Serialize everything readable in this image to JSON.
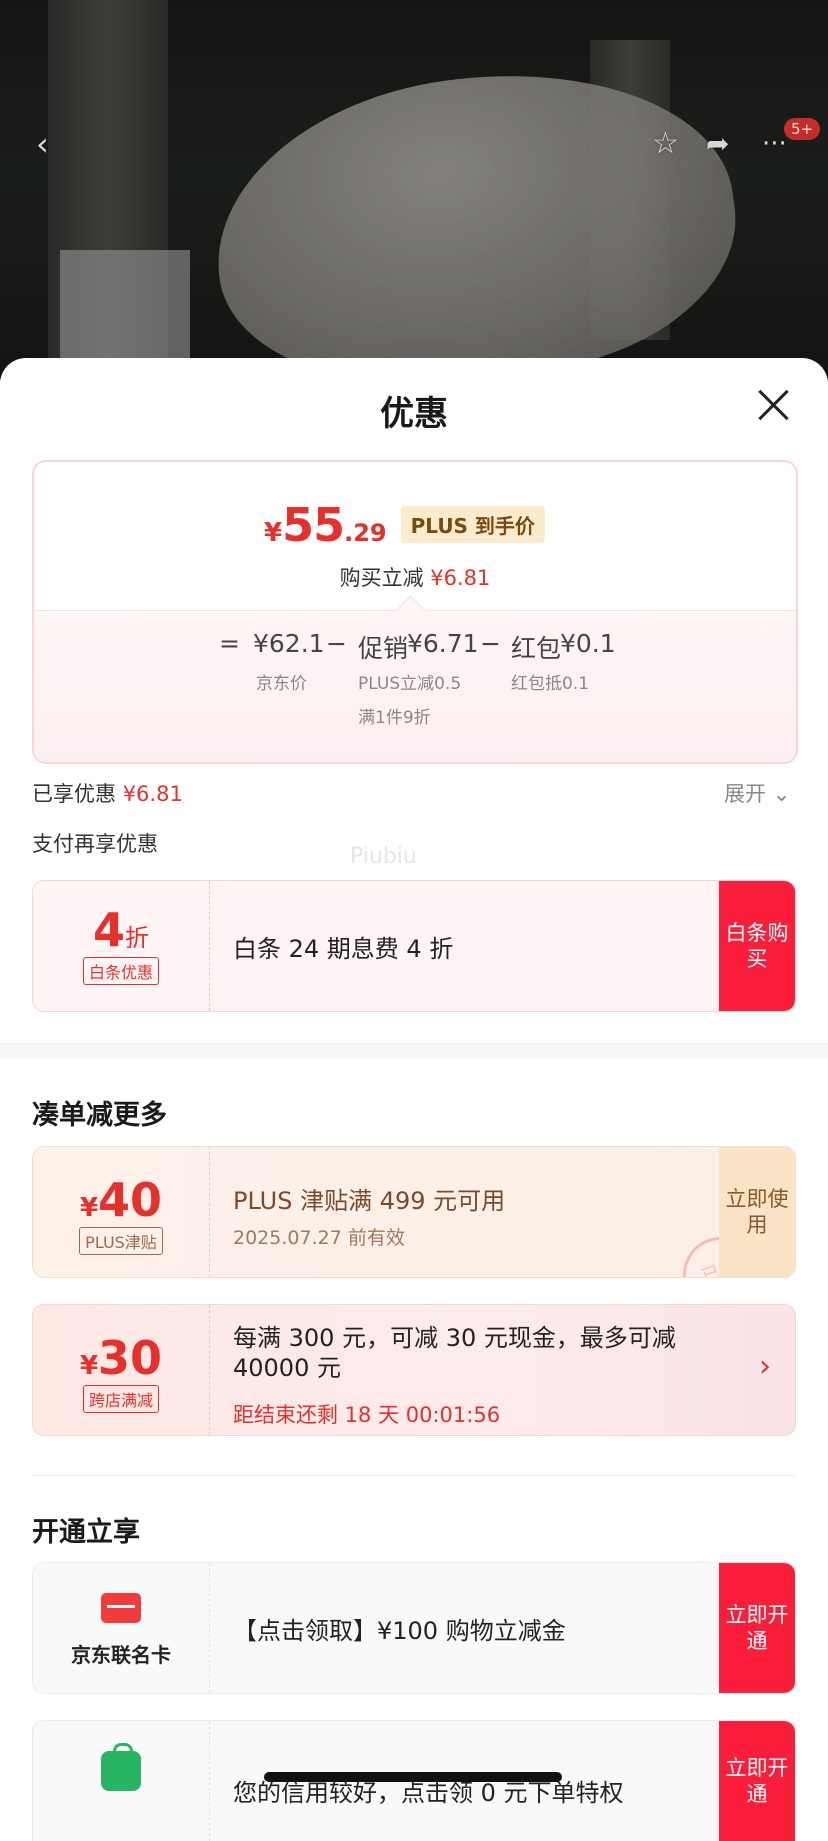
{
  "nav": {
    "back_glyph": "‹",
    "star_glyph": "☆",
    "share_glyph": "➦",
    "more_glyph": "···",
    "more_badge": "5+"
  },
  "sheet": {
    "title": "优惠"
  },
  "price_card": {
    "currency": "¥",
    "price_int": "55",
    "price_dec": ".29",
    "plus_tag": "PLUS 到手价",
    "instant_label": "购买立减",
    "instant_value": "¥6.81",
    "eq": "=",
    "jd_price": "¥62.1",
    "minus1": "−",
    "promo_label": "促销",
    "promo_value": "¥6.71",
    "minus2": "−",
    "redpack_label": "红包",
    "redpack_value": "¥0.1",
    "jd_price_sub": "京东价",
    "promo_sub_1": "PLUS立减0.5",
    "promo_sub_2": "满1件9折",
    "redpack_sub": "红包抵0.1"
  },
  "summary": {
    "enjoyed_label": "已享优惠",
    "enjoyed_value": "¥6.81",
    "expand_label": "展开",
    "expand_icon": "⌄",
    "pay_more": "支付再享优惠",
    "watermark": "Piubiu"
  },
  "baitiao": {
    "discount_num": "4",
    "discount_unit": "折",
    "tag": "白条优惠",
    "desc": "白条 24 期息费 4 折",
    "cta": "白条购买"
  },
  "more_section": {
    "title": "凑单减更多",
    "plus_coupon": {
      "currency": "¥",
      "amount": "40",
      "tag": "PLUS津贴",
      "title": "PLUS 津贴满 499 元可用",
      "valid": "2025.07.27 前有效",
      "stamp": "已领",
      "cta": "立即使用"
    },
    "cross_store": {
      "currency": "¥",
      "amount": "30",
      "tag": "跨店满减",
      "title": "每满 300 元，可减 30 元现金，最多可减 40000 元",
      "countdown": "距结束还剩 18 天 00:01:56",
      "arrow": "›"
    }
  },
  "open_section": {
    "title": "开通立享",
    "card": {
      "name": "京东联名卡",
      "desc": "【点击领取】¥100 购物立减金",
      "cta": "立即开通"
    },
    "credit": {
      "desc": "您的信用较好，点击领 0 元下单特权",
      "cta": "立即开通"
    }
  }
}
